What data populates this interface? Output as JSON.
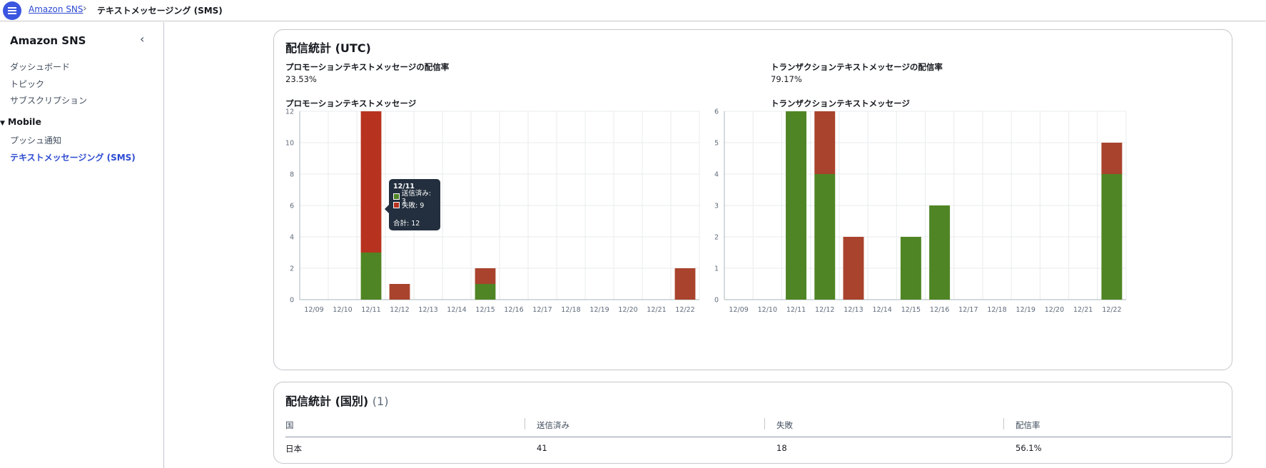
{
  "breadcrumb": {
    "service": "Amazon SNS",
    "current": "テキストメッセージング (SMS)"
  },
  "sidebar": {
    "title": "Amazon SNS",
    "items": [
      {
        "label": "ダッシュボード"
      },
      {
        "label": "トピック"
      },
      {
        "label": "サブスクリプション"
      }
    ],
    "section": "Mobile",
    "section_items": [
      {
        "label": "プッシュ通知"
      },
      {
        "label": "テキストメッセージング (SMS)"
      }
    ]
  },
  "stats": {
    "title": "配信統計 (UTC)",
    "promo_rate_label": "プロモーションテキストメッセージの配信率",
    "promo_rate_value": "23.53%",
    "trans_rate_label": "トランザクションテキストメッセージの配信率",
    "trans_rate_value": "79.17%"
  },
  "tooltip": {
    "date": "12/11",
    "sent": "送信済み: 3",
    "failed": "失敗: 9",
    "total": "合計: 12"
  },
  "colors": {
    "sent": "#4f8524",
    "failed": "#b7331f",
    "failed_alt": "#a9432d",
    "grid": "#e9ebed",
    "axis_text": "#5f6b7a"
  },
  "chart_data": [
    {
      "type": "bar",
      "stacked": true,
      "title": "プロモーションテキストメッセージ",
      "categories": [
        "12/09",
        "12/10",
        "12/11",
        "12/12",
        "12/13",
        "12/14",
        "12/15",
        "12/16",
        "12/17",
        "12/18",
        "12/19",
        "12/20",
        "12/21",
        "12/22"
      ],
      "series": [
        {
          "name": "送信済み",
          "values": [
            0,
            0,
            3,
            0,
            0,
            0,
            1,
            0,
            0,
            0,
            0,
            0,
            0,
            0
          ]
        },
        {
          "name": "失敗",
          "values": [
            0,
            0,
            9,
            1,
            0,
            0,
            1,
            0,
            0,
            0,
            0,
            0,
            0,
            2
          ]
        }
      ],
      "ylim": [
        0,
        12
      ],
      "yticks": [
        0,
        2,
        4,
        6,
        8,
        10,
        12
      ],
      "grid": true
    },
    {
      "type": "bar",
      "stacked": true,
      "title": "トランザクションテキストメッセージ",
      "categories": [
        "12/09",
        "12/10",
        "12/11",
        "12/12",
        "12/13",
        "12/14",
        "12/15",
        "12/16",
        "12/17",
        "12/18",
        "12/19",
        "12/20",
        "12/21",
        "12/22"
      ],
      "series": [
        {
          "name": "送信済み",
          "values": [
            0,
            0,
            6,
            4,
            0,
            0,
            2,
            3,
            0,
            0,
            0,
            0,
            0,
            4
          ]
        },
        {
          "name": "失敗",
          "values": [
            0,
            0,
            0,
            2,
            2,
            0,
            0,
            0,
            0,
            0,
            0,
            0,
            0,
            1
          ]
        }
      ],
      "ylim": [
        0,
        6
      ],
      "yticks": [
        0,
        1,
        2,
        3,
        4,
        5,
        6
      ],
      "grid": true
    }
  ],
  "country": {
    "title": "配信統計 (国別)",
    "count": "(1)",
    "columns": [
      "国",
      "送信済み",
      "失敗",
      "配信率"
    ],
    "rows": [
      [
        "日本",
        "41",
        "18",
        "56.1%"
      ]
    ]
  }
}
